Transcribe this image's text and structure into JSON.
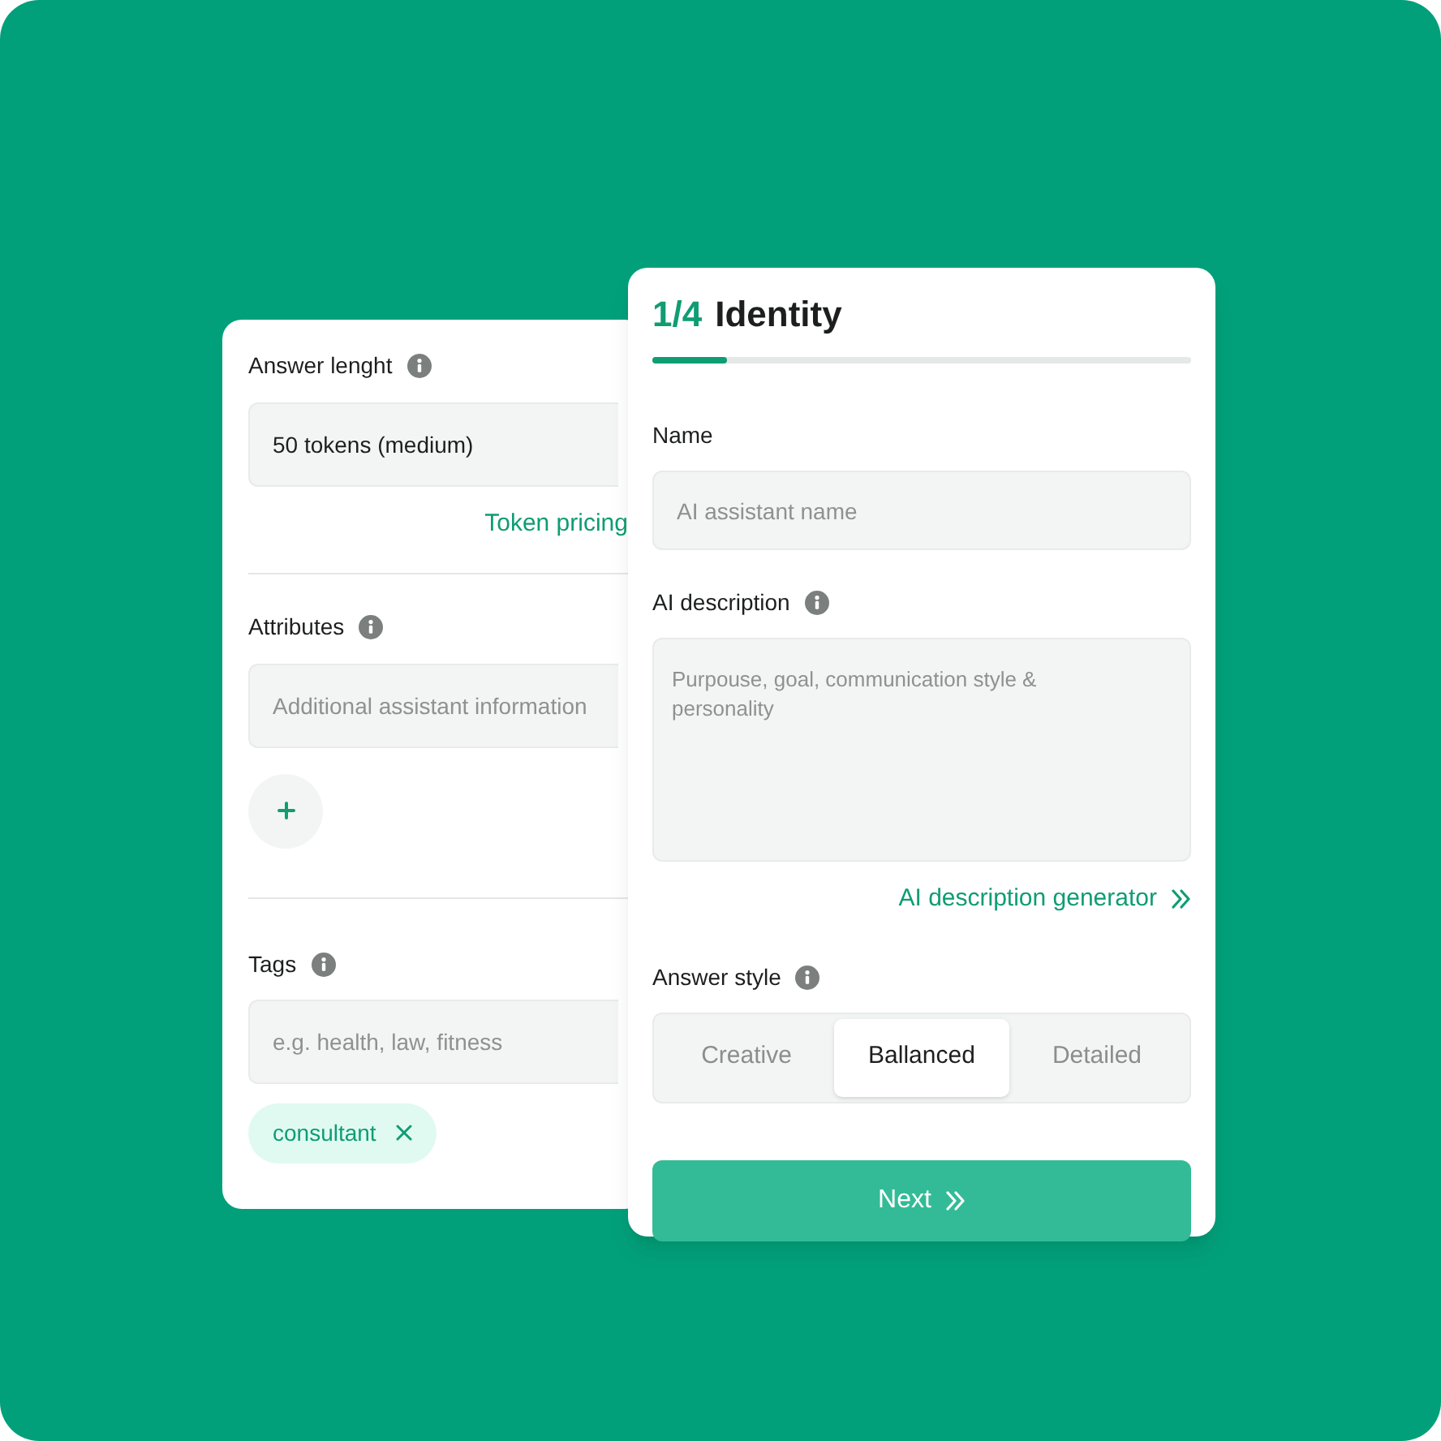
{
  "back_card": {
    "answer_length": {
      "label": "Answer lenght",
      "info": true,
      "value": "50 tokens (medium)",
      "link": "Token pricing"
    },
    "attributes": {
      "label": "Attributes",
      "info": true,
      "placeholder": "Additional assistant information"
    },
    "tags": {
      "label": "Tags",
      "info": true,
      "placeholder": "e.g. health, law, fitness",
      "items": [
        {
          "label": "consultant"
        }
      ]
    }
  },
  "front_card": {
    "step": "1/4",
    "title": "Identity",
    "progress": {
      "level": 0.14
    },
    "name": {
      "label": "Name",
      "info": false,
      "placeholder": "AI assistant name"
    },
    "description": {
      "label": "AI description",
      "info": true,
      "placeholder": "Purpouse, goal, communication style & personality",
      "link": "AI description generator"
    },
    "answer_style": {
      "label": "Answer style",
      "info": true,
      "options": [
        {
          "label": "Creative",
          "selected": false
        },
        {
          "label": "Ballanced",
          "selected": true
        },
        {
          "label": "Detailed",
          "selected": false
        }
      ]
    },
    "next_button": "Next"
  }
}
